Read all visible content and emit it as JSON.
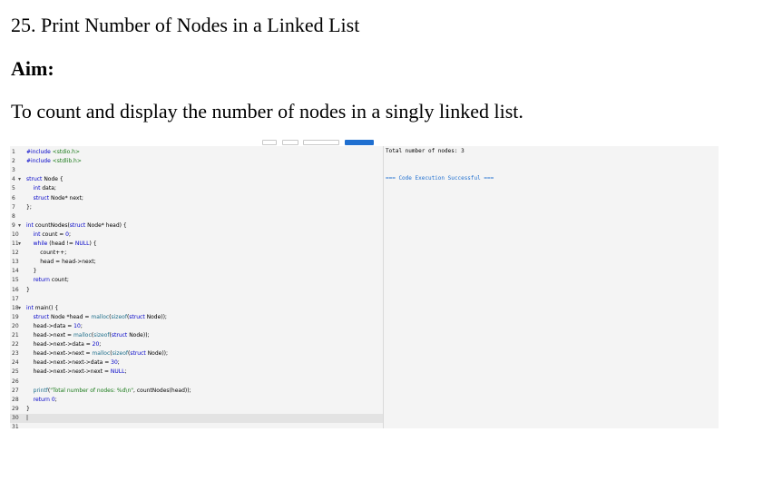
{
  "document": {
    "title": "25. Print Number of Nodes in a Linked List",
    "aim_heading": "Aim:",
    "aim_text": "To count and display the number of nodes in a singly linked list."
  },
  "editor": {
    "lines": [
      {
        "n": "1",
        "fold": "",
        "parts": [
          {
            "t": "#include ",
            "c": "kw"
          },
          {
            "t": "<stdio.h>",
            "c": "str"
          }
        ]
      },
      {
        "n": "2",
        "fold": "",
        "parts": [
          {
            "t": "#include ",
            "c": "kw"
          },
          {
            "t": "<stdlib.h>",
            "c": "str"
          }
        ]
      },
      {
        "n": "3",
        "fold": "",
        "parts": []
      },
      {
        "n": "4",
        "fold": "▾",
        "parts": [
          {
            "t": "struct",
            "c": "kw"
          },
          {
            "t": " Node {",
            "c": ""
          }
        ]
      },
      {
        "n": "5",
        "fold": "",
        "parts": [
          {
            "t": "    ",
            "c": ""
          },
          {
            "t": "int",
            "c": "kw"
          },
          {
            "t": " data;",
            "c": ""
          }
        ]
      },
      {
        "n": "6",
        "fold": "",
        "parts": [
          {
            "t": "    ",
            "c": ""
          },
          {
            "t": "struct",
            "c": "kw"
          },
          {
            "t": " Node* next;",
            "c": ""
          }
        ]
      },
      {
        "n": "7",
        "fold": "",
        "parts": [
          {
            "t": "};",
            "c": ""
          }
        ]
      },
      {
        "n": "8",
        "fold": "",
        "parts": []
      },
      {
        "n": "9",
        "fold": "▾",
        "parts": [
          {
            "t": "int",
            "c": "kw"
          },
          {
            "t": " countNodes(",
            "c": ""
          },
          {
            "t": "struct",
            "c": "kw"
          },
          {
            "t": " Node* head) {",
            "c": ""
          }
        ]
      },
      {
        "n": "10",
        "fold": "",
        "parts": [
          {
            "t": "    ",
            "c": ""
          },
          {
            "t": "int",
            "c": "kw"
          },
          {
            "t": " count = ",
            "c": ""
          },
          {
            "t": "0",
            "c": "kw"
          },
          {
            "t": ";",
            "c": ""
          }
        ]
      },
      {
        "n": "11",
        "fold": "▾",
        "parts": [
          {
            "t": "    ",
            "c": ""
          },
          {
            "t": "while",
            "c": "kw"
          },
          {
            "t": " (head != ",
            "c": ""
          },
          {
            "t": "NULL",
            "c": "kw"
          },
          {
            "t": ") {",
            "c": ""
          }
        ]
      },
      {
        "n": "12",
        "fold": "",
        "parts": [
          {
            "t": "        count++;",
            "c": ""
          }
        ]
      },
      {
        "n": "13",
        "fold": "",
        "parts": [
          {
            "t": "        head = head->next;",
            "c": ""
          }
        ]
      },
      {
        "n": "14",
        "fold": "",
        "parts": [
          {
            "t": "    }",
            "c": ""
          }
        ]
      },
      {
        "n": "15",
        "fold": "",
        "parts": [
          {
            "t": "    ",
            "c": ""
          },
          {
            "t": "return",
            "c": "kw"
          },
          {
            "t": " count;",
            "c": ""
          }
        ]
      },
      {
        "n": "16",
        "fold": "",
        "parts": [
          {
            "t": "}",
            "c": ""
          }
        ]
      },
      {
        "n": "17",
        "fold": "",
        "parts": []
      },
      {
        "n": "18",
        "fold": "▾",
        "parts": [
          {
            "t": "int",
            "c": "kw"
          },
          {
            "t": " main() {",
            "c": ""
          }
        ]
      },
      {
        "n": "19",
        "fold": "",
        "parts": [
          {
            "t": "    ",
            "c": ""
          },
          {
            "t": "struct",
            "c": "kw"
          },
          {
            "t": " Node *head = ",
            "c": ""
          },
          {
            "t": "malloc",
            "c": "cmt"
          },
          {
            "t": "(",
            "c": ""
          },
          {
            "t": "sizeof",
            "c": "cmt"
          },
          {
            "t": "(",
            "c": ""
          },
          {
            "t": "struct",
            "c": "kw"
          },
          {
            "t": " Node));",
            "c": ""
          }
        ]
      },
      {
        "n": "20",
        "fold": "",
        "parts": [
          {
            "t": "    head->data = ",
            "c": ""
          },
          {
            "t": "10",
            "c": "kw"
          },
          {
            "t": ";",
            "c": ""
          }
        ]
      },
      {
        "n": "21",
        "fold": "",
        "parts": [
          {
            "t": "    head->next = ",
            "c": ""
          },
          {
            "t": "malloc",
            "c": "cmt"
          },
          {
            "t": "(",
            "c": ""
          },
          {
            "t": "sizeof",
            "c": "cmt"
          },
          {
            "t": "(",
            "c": ""
          },
          {
            "t": "struct",
            "c": "kw"
          },
          {
            "t": " Node));",
            "c": ""
          }
        ]
      },
      {
        "n": "22",
        "fold": "",
        "parts": [
          {
            "t": "    head->next->data = ",
            "c": ""
          },
          {
            "t": "20",
            "c": "kw"
          },
          {
            "t": ";",
            "c": ""
          }
        ]
      },
      {
        "n": "23",
        "fold": "",
        "parts": [
          {
            "t": "    head->next->next = ",
            "c": ""
          },
          {
            "t": "malloc",
            "c": "cmt"
          },
          {
            "t": "(",
            "c": ""
          },
          {
            "t": "sizeof",
            "c": "cmt"
          },
          {
            "t": "(",
            "c": ""
          },
          {
            "t": "struct",
            "c": "kw"
          },
          {
            "t": " Node));",
            "c": ""
          }
        ]
      },
      {
        "n": "24",
        "fold": "",
        "parts": [
          {
            "t": "    head->next->next->data = ",
            "c": ""
          },
          {
            "t": "30",
            "c": "kw"
          },
          {
            "t": ";",
            "c": ""
          }
        ]
      },
      {
        "n": "25",
        "fold": "",
        "parts": [
          {
            "t": "    head->next->next->next = ",
            "c": ""
          },
          {
            "t": "NULL",
            "c": "kw"
          },
          {
            "t": ";",
            "c": ""
          }
        ]
      },
      {
        "n": "26",
        "fold": "",
        "parts": []
      },
      {
        "n": "27",
        "fold": "",
        "parts": [
          {
            "t": "    ",
            "c": ""
          },
          {
            "t": "printf",
            "c": "cmt"
          },
          {
            "t": "(",
            "c": ""
          },
          {
            "t": "\"Total number of nodes: %d\\n\"",
            "c": "str"
          },
          {
            "t": ", countNodes(head));",
            "c": ""
          }
        ]
      },
      {
        "n": "28",
        "fold": "",
        "parts": [
          {
            "t": "    ",
            "c": ""
          },
          {
            "t": "return",
            "c": "kw"
          },
          {
            "t": " ",
            "c": ""
          },
          {
            "t": "0",
            "c": "kw"
          },
          {
            "t": ";",
            "c": ""
          }
        ]
      },
      {
        "n": "29",
        "fold": "",
        "parts": [
          {
            "t": "}",
            "c": ""
          }
        ]
      },
      {
        "n": "30",
        "fold": "",
        "parts": [
          {
            "t": "|",
            "c": ""
          }
        ]
      },
      {
        "n": "31",
        "fold": "",
        "parts": []
      }
    ]
  },
  "output": {
    "result": "Total number of nodes: 3",
    "status": "=== Code Execution Successful ==="
  },
  "colors": {
    "keyword": "#0000c8",
    "string": "#197a19",
    "function": "#1f6f8b",
    "run_button": "#1f6fd0",
    "success": "#1f6fd0"
  }
}
